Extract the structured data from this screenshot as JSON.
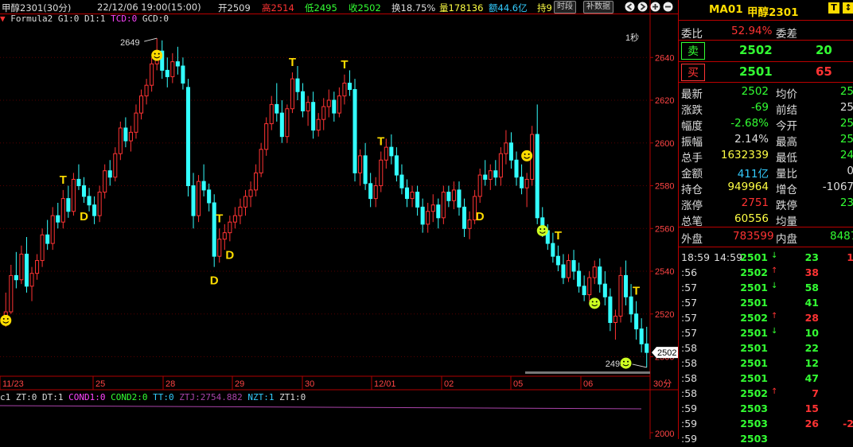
{
  "header": {
    "symbol": "甲醇2301(30分)",
    "datetime": "22/12/06 19:00(15:00)",
    "open": "开2509",
    "high": "高2514",
    "low": "低2495",
    "close": "收2502",
    "turnover": "换18.75%",
    "volume": "量178136",
    "amount": "额44.6亿",
    "position": "持9",
    "btn_time": "时段",
    "btn_supp": "补数据"
  },
  "formula_line": {
    "name": "Formula2",
    "g1": "G1:0",
    "d1": "D1:1",
    "tcd": "TCD:0",
    "gcd": "GCD:0"
  },
  "chart": {
    "period_label": "1秒",
    "high_label": "2649",
    "low_label": "2495",
    "current_price": "2502",
    "y_ticks": [
      "2640",
      "2620",
      "2600",
      "2580",
      "2560",
      "2540",
      "2520",
      "2500"
    ],
    "x_labels": [
      "11/23",
      "25",
      "28",
      "29",
      "30",
      "12/01",
      "02",
      "05",
      "06"
    ],
    "x_unit": "30分"
  },
  "chart_data": {
    "type": "candlestick",
    "ylim": [
      2492,
      2652
    ],
    "y_ticks": [
      2640,
      2620,
      2600,
      2580,
      2560,
      2540,
      2520,
      2500
    ],
    "candles": [
      [
        2517,
        2530,
        2514,
        2521
      ],
      [
        2521,
        2543,
        2520,
        2538
      ],
      [
        2538,
        2549,
        2532,
        2536
      ],
      [
        2536,
        2552,
        2534,
        2548
      ],
      [
        2548,
        2556,
        2530,
        2533
      ],
      [
        2533,
        2542,
        2526,
        2539
      ],
      [
        2539,
        2548,
        2536,
        2545
      ],
      [
        2545,
        2560,
        2542,
        2557
      ],
      [
        2557,
        2564,
        2550,
        2553
      ],
      [
        2553,
        2570,
        2550,
        2566
      ],
      [
        2566,
        2572,
        2560,
        2563
      ],
      [
        2563,
        2578,
        2560,
        2574
      ],
      [
        2574,
        2580,
        2565,
        2568
      ],
      [
        2568,
        2586,
        2566,
        2583
      ],
      [
        2583,
        2590,
        2578,
        2580
      ],
      [
        2580,
        2584,
        2572,
        2575
      ],
      [
        2575,
        2579,
        2568,
        2571
      ],
      [
        2571,
        2575,
        2562,
        2566
      ],
      [
        2566,
        2580,
        2563,
        2577
      ],
      [
        2577,
        2590,
        2574,
        2587
      ],
      [
        2587,
        2592,
        2580,
        2584
      ],
      [
        2584,
        2598,
        2582,
        2595
      ],
      [
        2595,
        2610,
        2592,
        2607
      ],
      [
        2607,
        2612,
        2598,
        2601
      ],
      [
        2601,
        2608,
        2596,
        2605
      ],
      [
        2605,
        2618,
        2602,
        2614
      ],
      [
        2614,
        2625,
        2611,
        2622
      ],
      [
        2622,
        2630,
        2618,
        2627
      ],
      [
        2627,
        2640,
        2624,
        2637
      ],
      [
        2637,
        2649,
        2634,
        2643
      ],
      [
        2643,
        2648,
        2630,
        2634
      ],
      [
        2634,
        2640,
        2626,
        2631
      ],
      [
        2631,
        2642,
        2628,
        2638
      ],
      [
        2638,
        2645,
        2632,
        2636
      ],
      [
        2636,
        2640,
        2625,
        2628
      ],
      [
        2626,
        2630,
        2575,
        2580
      ],
      [
        2580,
        2586,
        2560,
        2566
      ],
      [
        2566,
        2585,
        2563,
        2582
      ],
      [
        2582,
        2590,
        2575,
        2578
      ],
      [
        2578,
        2581,
        2568,
        2572
      ],
      [
        2572,
        2576,
        2542,
        2547
      ],
      [
        2547,
        2560,
        2544,
        2555
      ],
      [
        2555,
        2562,
        2550,
        2558
      ],
      [
        2558,
        2566,
        2554,
        2563
      ],
      [
        2563,
        2570,
        2560,
        2566
      ],
      [
        2566,
        2574,
        2562,
        2570
      ],
      [
        2570,
        2578,
        2566,
        2575
      ],
      [
        2575,
        2582,
        2570,
        2578
      ],
      [
        2578,
        2590,
        2575,
        2586
      ],
      [
        2586,
        2600,
        2584,
        2597
      ],
      [
        2597,
        2612,
        2594,
        2609
      ],
      [
        2609,
        2622,
        2606,
        2618
      ],
      [
        2618,
        2628,
        2610,
        2614
      ],
      [
        2614,
        2620,
        2600,
        2603
      ],
      [
        2603,
        2618,
        2600,
        2616
      ],
      [
        2616,
        2633,
        2614,
        2630
      ],
      [
        2630,
        2636,
        2620,
        2624
      ],
      [
        2624,
        2628,
        2612,
        2615
      ],
      [
        2615,
        2622,
        2608,
        2619
      ],
      [
        2619,
        2624,
        2602,
        2606
      ],
      [
        2606,
        2614,
        2603,
        2611
      ],
      [
        2611,
        2621,
        2606,
        2617
      ],
      [
        2617,
        2625,
        2612,
        2620
      ],
      [
        2620,
        2624,
        2610,
        2614
      ],
      [
        2614,
        2626,
        2612,
        2622
      ],
      [
        2622,
        2632,
        2618,
        2628
      ],
      [
        2628,
        2634,
        2622,
        2625
      ],
      [
        2625,
        2630,
        2582,
        2586
      ],
      [
        2586,
        2597,
        2580,
        2594
      ],
      [
        2594,
        2600,
        2578,
        2581
      ],
      [
        2581,
        2586,
        2570,
        2574
      ],
      [
        2574,
        2584,
        2570,
        2580
      ],
      [
        2580,
        2596,
        2577,
        2592
      ],
      [
        2592,
        2602,
        2588,
        2598
      ],
      [
        2598,
        2604,
        2590,
        2594
      ],
      [
        2594,
        2598,
        2582,
        2585
      ],
      [
        2585,
        2590,
        2576,
        2579
      ],
      [
        2579,
        2583,
        2570,
        2574
      ],
      [
        2574,
        2580,
        2570,
        2577
      ],
      [
        2577,
        2580,
        2566,
        2570
      ],
      [
        2570,
        2574,
        2558,
        2562
      ],
      [
        2562,
        2572,
        2558,
        2568
      ],
      [
        2568,
        2576,
        2563,
        2571
      ],
      [
        2571,
        2574,
        2560,
        2565
      ],
      [
        2565,
        2580,
        2562,
        2577
      ],
      [
        2577,
        2580,
        2570,
        2573
      ],
      [
        2573,
        2582,
        2569,
        2578
      ],
      [
        2578,
        2582,
        2566,
        2570
      ],
      [
        2570,
        2574,
        2556,
        2560
      ],
      [
        2560,
        2568,
        2555,
        2564
      ],
      [
        2564,
        2578,
        2562,
        2575
      ],
      [
        2575,
        2588,
        2572,
        2585
      ],
      [
        2585,
        2592,
        2580,
        2583
      ],
      [
        2583,
        2590,
        2578,
        2587
      ],
      [
        2587,
        2592,
        2580,
        2584
      ],
      [
        2584,
        2598,
        2580,
        2595
      ],
      [
        2595,
        2606,
        2590,
        2600
      ],
      [
        2600,
        2605,
        2588,
        2592
      ],
      [
        2592,
        2596,
        2580,
        2584
      ],
      [
        2584,
        2590,
        2576,
        2579
      ],
      [
        2579,
        2586,
        2570,
        2583
      ],
      [
        2583,
        2608,
        2580,
        2604
      ],
      [
        2604,
        2618,
        2562,
        2565
      ],
      [
        2565,
        2570,
        2556,
        2559
      ],
      [
        2559,
        2562,
        2550,
        2553
      ],
      [
        2553,
        2558,
        2544,
        2547
      ],
      [
        2547,
        2552,
        2540,
        2543
      ],
      [
        2543,
        2548,
        2534,
        2537
      ],
      [
        2537,
        2548,
        2535,
        2545
      ],
      [
        2545,
        2550,
        2536,
        2540
      ],
      [
        2540,
        2544,
        2530,
        2533
      ],
      [
        2533,
        2538,
        2526,
        2529
      ],
      [
        2529,
        2540,
        2526,
        2537
      ],
      [
        2537,
        2545,
        2534,
        2542
      ],
      [
        2542,
        2546,
        2530,
        2534
      ],
      [
        2534,
        2540,
        2524,
        2528
      ],
      [
        2528,
        2532,
        2512,
        2516
      ],
      [
        2516,
        2522,
        2508,
        2519
      ],
      [
        2519,
        2542,
        2516,
        2538
      ],
      [
        2538,
        2545,
        2524,
        2528
      ],
      [
        2528,
        2534,
        2516,
        2520
      ],
      [
        2520,
        2526,
        2508,
        2513
      ],
      [
        2513,
        2518,
        2502,
        2506
      ],
      [
        2506,
        2514,
        2495,
        2502
      ]
    ],
    "x_labels": [
      "11/23",
      "25",
      "28",
      "29",
      "30",
      "12/01",
      "02",
      "05",
      "06"
    ],
    "markers": [
      {
        "label": "T",
        "i": 11
      },
      {
        "label": "D",
        "i": 15
      },
      {
        "label": "T",
        "i": 41
      },
      {
        "label": "D",
        "i": 40
      },
      {
        "label": "D",
        "i": 43
      },
      {
        "label": "T",
        "i": 55
      },
      {
        "label": "T",
        "i": 65
      },
      {
        "label": "T",
        "i": 72
      },
      {
        "label": "D",
        "i": 91
      },
      {
        "label": "T",
        "i": 106
      },
      {
        "label": "T",
        "i": 121
      }
    ],
    "smiles": [
      {
        "i": 0,
        "y": 2517,
        "c": "#ffdd00"
      },
      {
        "i": 29,
        "y": 2641,
        "c": "#ffdd00"
      },
      {
        "i": 100,
        "y": 2594,
        "c": "#ffdd00"
      },
      {
        "i": 103,
        "y": 2559,
        "c": "#ccff22"
      },
      {
        "i": 113,
        "y": 2525,
        "c": "#ccff22"
      },
      {
        "i": 119,
        "y": 2497,
        "c": "#ccff22"
      }
    ]
  },
  "indicator_line": {
    "c1": "c1",
    "zt": "ZT:0",
    "dt": "DT:1",
    "cond1": "COND1:0",
    "cond2": "COND2:0",
    "tt": "TT:0",
    "ztj": "ZTJ:2754.882",
    "nzt": "NZT:1",
    "zt1": "ZT1:0",
    "y_tick": "2000"
  },
  "right_panel": {
    "code": "MA01",
    "name": "甲醇2301",
    "wb_label": "委比",
    "wb_value": "52.94%",
    "wc_label": "委差",
    "sell_label": "卖",
    "sell_price": "2502",
    "sell_vol": "20",
    "buy_label": "买",
    "buy_price": "2501",
    "buy_vol": "65",
    "stats": [
      {
        "l1": "最新",
        "v1": "2502",
        "c1": "#33ff33",
        "l2": "均价",
        "v2": "25",
        "c2": "#33ff33"
      },
      {
        "l1": "涨跌",
        "v1": "-69",
        "c1": "#33ff33",
        "l2": "前结",
        "v2": "25",
        "c2": "#dddddd"
      },
      {
        "l1": "幅度",
        "v1": "-2.68%",
        "c1": "#33ff33",
        "l2": "今开",
        "v2": "25",
        "c2": "#33ff33"
      },
      {
        "l1": "振幅",
        "v1": "2.14%",
        "c1": "#dddddd",
        "l2": "最高",
        "v2": "25",
        "c2": "#33ff33"
      },
      {
        "l1": "总手",
        "v1": "1632339",
        "c1": "#ffff44",
        "l2": "最低",
        "v2": "24",
        "c2": "#33ff33"
      },
      {
        "l1": "金额",
        "v1": "411亿",
        "c1": "#33ccff",
        "l2": "量比",
        "v2": "0",
        "c2": "#dddddd"
      },
      {
        "l1": "持仓",
        "v1": "949964",
        "c1": "#ffff44",
        "l2": "增仓",
        "v2": "-1067",
        "c2": "#dddddd"
      },
      {
        "l1": "涨停",
        "v1": "2751",
        "c1": "#ff3333",
        "l2": "跌停",
        "v2": "23",
        "c2": "#33ff33"
      },
      {
        "l1": "总笔",
        "v1": "60556",
        "c1": "#ffff44",
        "l2": "均量",
        "v2": "",
        "c2": "#dddddd"
      }
    ],
    "outer_label": "外盘",
    "outer_value": "783599",
    "inner_label": "内盘",
    "inner_value": "8487",
    "ticks": [
      {
        "t": "18:59",
        "t2": "14:59",
        "p": "2501",
        "a": "↓",
        "v": "23",
        "vc": "#33ff33",
        "x": "1"
      },
      {
        "t": ":56",
        "t2": "",
        "p": "2502",
        "a": "↑",
        "v": "38",
        "vc": "#ff3333",
        "x": ""
      },
      {
        "t": ":57",
        "t2": "",
        "p": "2501",
        "a": "↓",
        "v": "58",
        "vc": "#33ff33",
        "x": ""
      },
      {
        "t": ":57",
        "t2": "",
        "p": "2501",
        "a": "",
        "v": "41",
        "vc": "#33ff33",
        "x": ""
      },
      {
        "t": ":57",
        "t2": "",
        "p": "2502",
        "a": "↑",
        "v": "28",
        "vc": "#ff3333",
        "x": ""
      },
      {
        "t": ":57",
        "t2": "",
        "p": "2501",
        "a": "↓",
        "v": "10",
        "vc": "#33ff33",
        "x": ""
      },
      {
        "t": ":58",
        "t2": "",
        "p": "2501",
        "a": "",
        "v": "22",
        "vc": "#33ff33",
        "x": ""
      },
      {
        "t": ":58",
        "t2": "",
        "p": "2501",
        "a": "",
        "v": "12",
        "vc": "#33ff33",
        "x": ""
      },
      {
        "t": ":58",
        "t2": "",
        "p": "2501",
        "a": "",
        "v": "47",
        "vc": "#33ff33",
        "x": ""
      },
      {
        "t": ":58",
        "t2": "",
        "p": "2502",
        "a": "↑",
        "v": "7",
        "vc": "#ff3333",
        "x": ""
      },
      {
        "t": ":59",
        "t2": "",
        "p": "2503",
        "a": "",
        "v": "15",
        "vc": "#ff3333",
        "x": ""
      },
      {
        "t": ":59",
        "t2": "",
        "p": "2503",
        "a": "",
        "v": "26",
        "vc": "#ff3333",
        "x": "-2"
      },
      {
        "t": ":59",
        "t2": "",
        "p": "2503",
        "a": "",
        "v": "",
        "vc": "#ff3333",
        "x": ""
      }
    ]
  },
  "colors": {
    "up": "#ff3333",
    "down": "#33ffff",
    "axis": "#b00000",
    "marker": "#ffdd00"
  }
}
